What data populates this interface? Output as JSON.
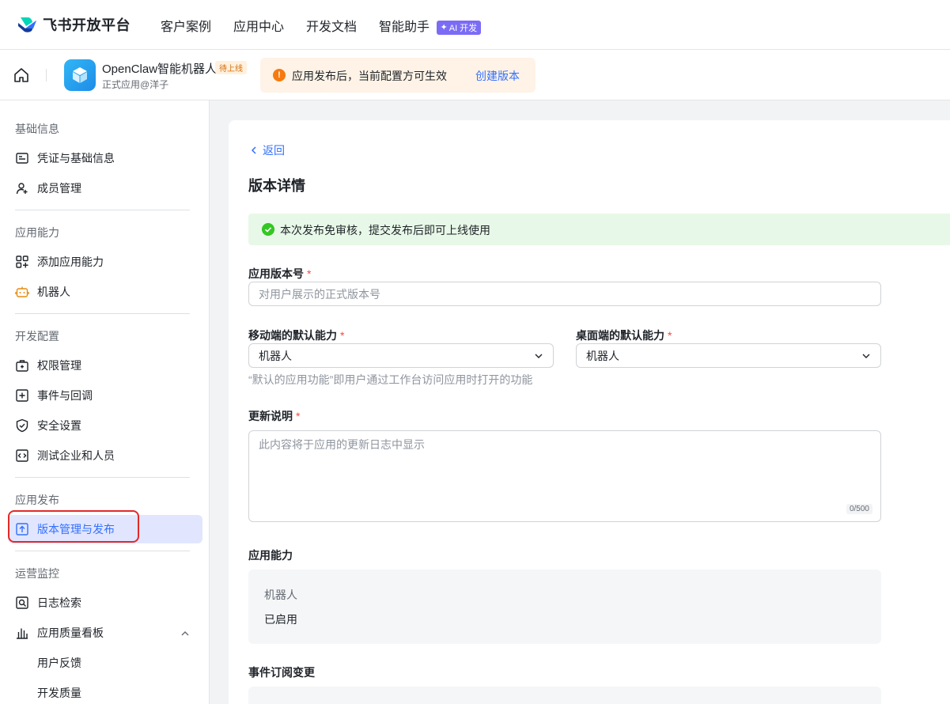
{
  "topnav": {
    "brand": "飞书开放平台",
    "items": [
      "客户案例",
      "应用中心",
      "开发文档",
      "智能助手"
    ],
    "ai_badge": "AI 开发"
  },
  "app": {
    "name": "OpenClaw智能机器人",
    "status": "待上线",
    "subtitle": "正式应用@洋子",
    "notice": "应用发布后，当前配置方可生效",
    "notice_action": "创建版本"
  },
  "sidebar": {
    "groups": {
      "basic": "基础信息",
      "capability": "应用能力",
      "dev": "开发配置",
      "release": "应用发布",
      "ops": "运营监控"
    },
    "items": {
      "credentials": "凭证与基础信息",
      "members": "成员管理",
      "add_capability": "添加应用能力",
      "bot": "机器人",
      "permissions": "权限管理",
      "events": "事件与回调",
      "security": "安全设置",
      "test_org": "测试企业和人员",
      "versions": "版本管理与发布",
      "logs": "日志检索",
      "quality": "应用质量看板",
      "feedback": "用户反馈",
      "dev_quality": "开发质量"
    }
  },
  "main": {
    "back": "返回",
    "title": "版本详情",
    "success_msg": "本次发布免审核，提交发布后即可上线使用",
    "version_label": "应用版本号",
    "version_placeholder": "对用户展示的正式版本号",
    "mobile_label": "移动端的默认能力",
    "mobile_value": "机器人",
    "desktop_label": "桌面端的默认能力",
    "desktop_value": "机器人",
    "default_hint": "“默认的应用功能”即用户通过工作台访问应用时打开的功能",
    "notes_label": "更新说明",
    "notes_placeholder": "此内容将于应用的更新日志中显示",
    "notes_counter": "0/500",
    "capability_section": "应用能力",
    "capability_name": "机器人",
    "capability_status": "已启用",
    "events_section": "事件订阅变更",
    "required_mark": "*"
  },
  "colors": {
    "accent": "#3370ff",
    "active_bg": "#e1e6fe",
    "highlight": "#e12a2a",
    "success_bg": "#e8f8e8",
    "notice_bg": "#fef3e6"
  }
}
